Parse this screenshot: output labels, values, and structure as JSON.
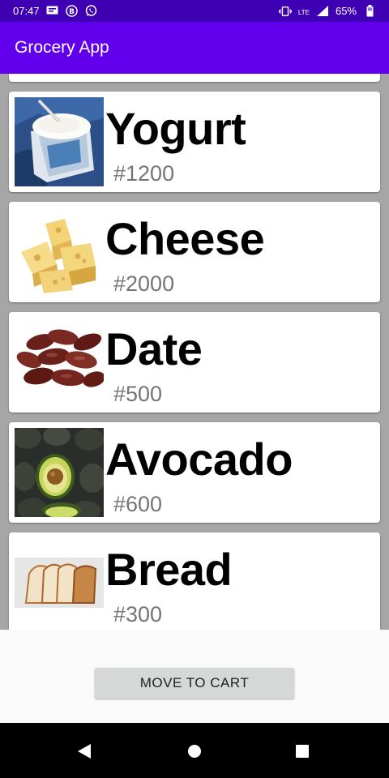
{
  "status_bar": {
    "time": "07:47",
    "network": "LTE",
    "battery": "65%",
    "left_icons": [
      "message-icon",
      "b-circle-icon",
      "whatsapp-icon"
    ],
    "right_icons": [
      "vibrate-icon",
      "lte-icon",
      "signal-icon",
      "battery-icon"
    ]
  },
  "app_bar": {
    "title": "Grocery App"
  },
  "products": [
    {
      "name": "Yogurt",
      "price": "#1200",
      "image": "yogurt-image"
    },
    {
      "name": "Cheese",
      "price": "#2000",
      "image": "cheese-image"
    },
    {
      "name": "Date",
      "price": "#500",
      "image": "dates-image"
    },
    {
      "name": "Avocado",
      "price": "#600",
      "image": "avocado-image"
    },
    {
      "name": "Bread",
      "price": "#300",
      "image": "bread-image"
    }
  ],
  "actions": {
    "move_to_cart": "MOVE TO CART"
  },
  "nav": {
    "icons": [
      "back-icon",
      "home-icon",
      "recents-icon"
    ]
  },
  "colors": {
    "status_bar": "#3f00b4",
    "app_bar": "#6200ee",
    "list_background": "#a6a6a6",
    "price_text": "#757575"
  }
}
